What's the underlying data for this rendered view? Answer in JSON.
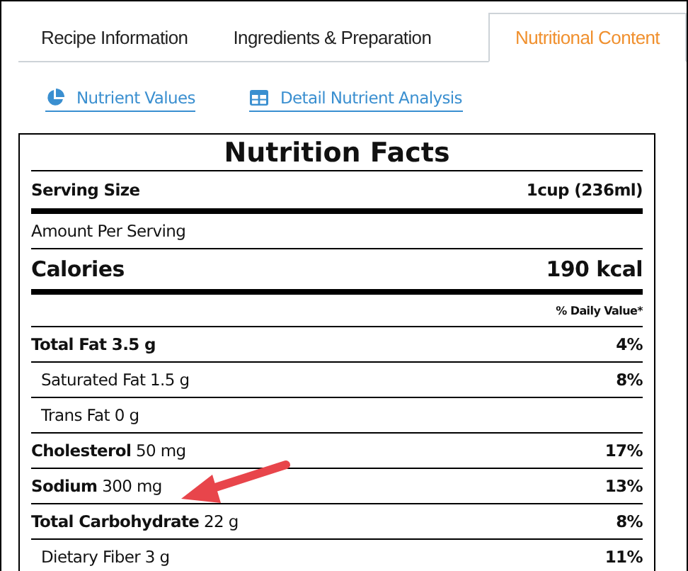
{
  "tabs": [
    {
      "label": "Recipe Information",
      "selected": false
    },
    {
      "label": "Ingredients & Preparation",
      "selected": false
    },
    {
      "label": "Nutritional Content",
      "selected": true
    }
  ],
  "links": [
    {
      "label": "Nutrient Values",
      "kind": "pie"
    },
    {
      "label": "Detail Nutrient Analysis",
      "kind": "table"
    }
  ],
  "label": {
    "title": "Nutrition Facts",
    "serving_size": {
      "name": "Serving Size",
      "value": "1cup (236ml)"
    },
    "amount_per_serving": "Amount Per Serving",
    "calories": {
      "name": "Calories",
      "value": "190 kcal"
    },
    "daily_value_header": "% Daily Value*",
    "rows": [
      {
        "kind": "main",
        "text": "**Total Fat 3.5 g**",
        "percent": "4%"
      },
      {
        "kind": "sub",
        "text": "Saturated Fat 1.5 g",
        "percent": "8%"
      },
      {
        "kind": "sub",
        "text": "Trans Fat 0 g"
      },
      {
        "kind": "main",
        "text": "**Cholesterol** 50 mg",
        "percent": "17%"
      },
      {
        "kind": "main",
        "text": "**Sodium** 300 mg",
        "percent": "13%"
      },
      {
        "kind": "main",
        "text": "**Total Carbohydrate** 22 g",
        "percent": "8%"
      },
      {
        "kind": "sub",
        "text": "Dietary Fiber 3 g",
        "percent": "11%"
      }
    ]
  }
}
